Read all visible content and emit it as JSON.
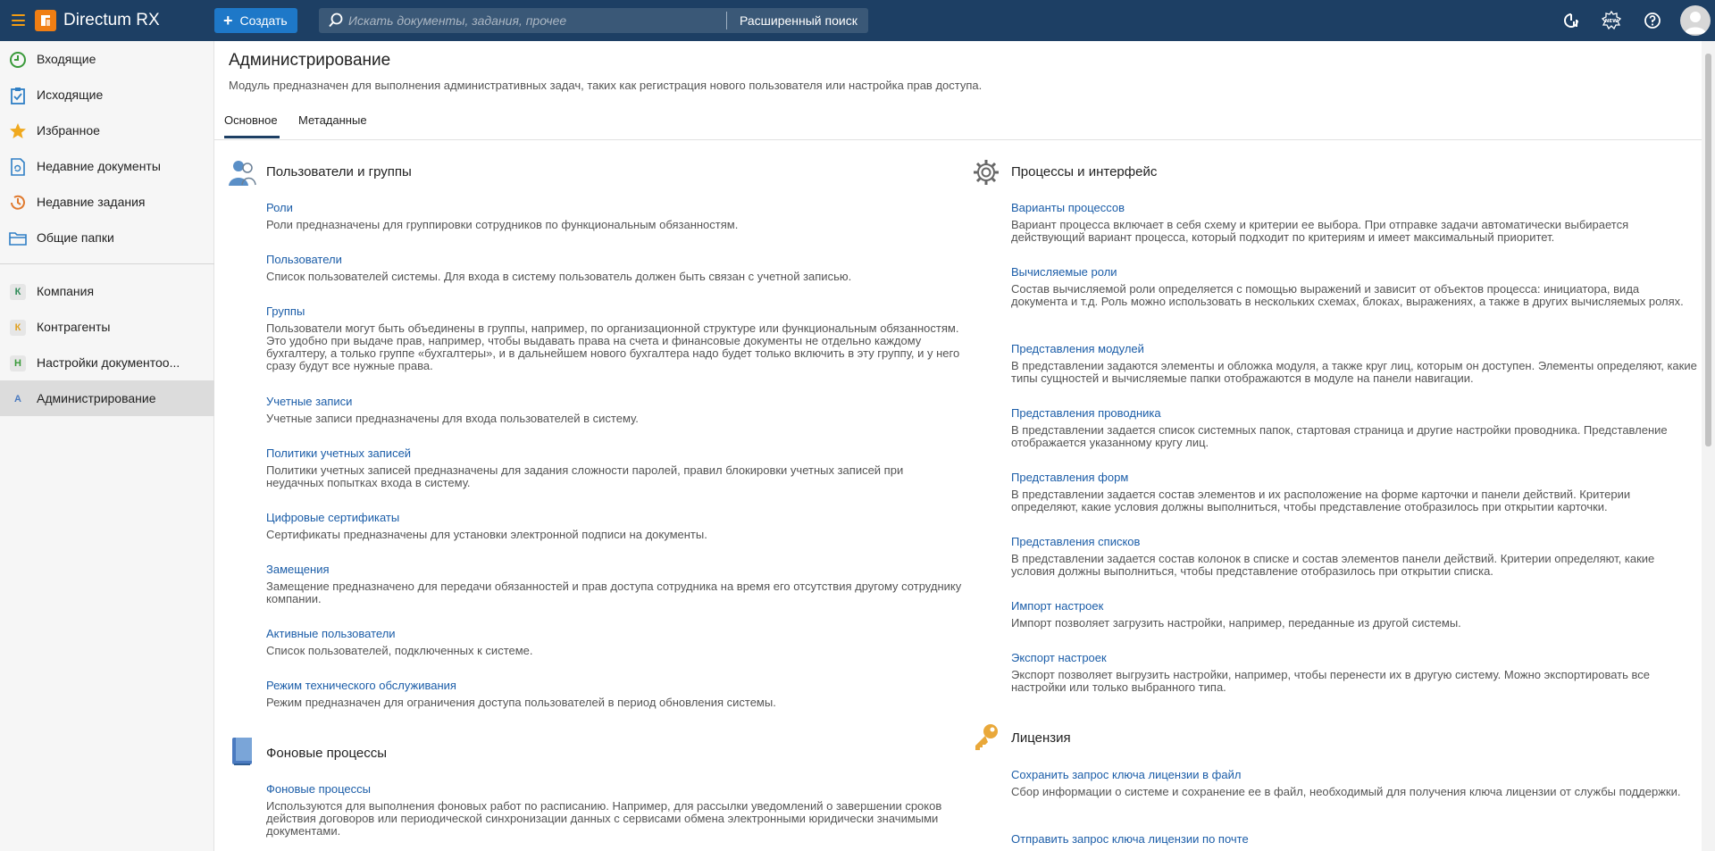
{
  "app": {
    "name": "Directum RX"
  },
  "topbar": {
    "create_label": "Создать",
    "search_placeholder": "Искать документы, задания, прочее",
    "advanced_search_label": "Расширенный поиск"
  },
  "sidebar": {
    "items": [
      {
        "label": "Входящие",
        "icon": "clock-in-icon"
      },
      {
        "label": "Исходящие",
        "icon": "clipboard-check-icon"
      },
      {
        "label": "Избранное",
        "icon": "star-icon"
      },
      {
        "label": "Недавние документы",
        "icon": "recent-docs-icon"
      },
      {
        "label": "Недавние задания",
        "icon": "recent-tasks-icon"
      },
      {
        "label": "Общие папки",
        "icon": "folder-icon"
      }
    ],
    "modules": [
      {
        "letter": "К",
        "label": "Компания",
        "color": "#2e8b57"
      },
      {
        "letter": "К",
        "label": "Контрагенты",
        "color": "#e0a020"
      },
      {
        "letter": "Н",
        "label": "Настройки документоо...",
        "color": "#3a9a3a"
      },
      {
        "letter": "А",
        "label": "Администрирование",
        "color": "#4a7ac0"
      }
    ]
  },
  "page": {
    "title": "Администрирование",
    "description": "Модуль предназначен для выполнения административных задач, таких как регистрация нового пользователя или настройка прав доступа.",
    "tabs": [
      "Основное",
      "Метаданные"
    ]
  },
  "left": {
    "users_title": "Пользователи и группы",
    "users_items": [
      {
        "title": "Роли",
        "desc": "Роли предназначены для группировки сотрудников по функциональным обязанностям."
      },
      {
        "title": "Пользователи",
        "desc": "Список пользователей системы. Для входа в систему пользователь должен быть связан с учетной записью."
      },
      {
        "title": "Группы",
        "desc": "Пользователи могут быть объединены в группы, например, по организационной структуре или функциональным обязанностям. Это удобно при выдаче прав, например, чтобы выдавать права на счета и финансовые документы не отдельно каждому бухгалтеру, а только группе «бухгалтеры», и в дальнейшем нового бухгалтера надо будет только включить в эту группу, и у него сразу будут все нужные права."
      },
      {
        "title": "Учетные записи",
        "desc": "Учетные записи предназначены для входа пользователей в систему."
      },
      {
        "title": "Политики учетных записей",
        "desc": "Политики учетных записей предназначены для задания сложности паролей, правил блокировки учетных записей при неудачных попытках входа в систему."
      },
      {
        "title": "Цифровые сертификаты",
        "desc": "Сертификаты предназначены для установки электронной подписи на документы."
      },
      {
        "title": "Замещения",
        "desc": "Замещение предназначено для передачи обязанностей и прав доступа сотрудника на время его отсутствия другому сотруднику компании."
      },
      {
        "title": "Активные пользователи",
        "desc": "Список пользователей, подключенных к системе."
      },
      {
        "title": "Режим технического обслуживания",
        "desc": "Режим предназначен для ограничения доступа пользователей в период обновления системы."
      }
    ],
    "bg_title": "Фоновые процессы",
    "bg_items": [
      {
        "title": "Фоновые процессы",
        "desc": "Используются для выполнения фоновых работ по расписанию. Например, для рассылки уведомлений о завершении сроков действия договоров или периодической синхронизации данных с сервисами обмена электронными юридически значимыми документами."
      }
    ]
  },
  "right": {
    "proc_title": "Процессы и интерфейс",
    "proc_items": [
      {
        "title": "Варианты процессов",
        "desc": "Вариант процесса включает в себя схему и критерии ее выбора. При отправке задачи автоматически выбирается действующий вариант процесса, который подходит по критериям и имеет максимальный приоритет."
      },
      {
        "title": "Вычисляемые роли",
        "desc": "Состав вычисляемой роли определяется с помощью выражений и зависит от объектов процесса: инициатора, вида документа и т.д. Роль можно использовать в нескольких схемах, блоках, выражениях, а также в других вычисляемых ролях."
      },
      {
        "title": "Представления модулей",
        "desc": "В представлении задаются элементы и обложка модуля, а также круг лиц, которым он доступен. Элементы определяют, какие типы сущностей и вычисляемые папки отображаются в модуле на панели навигации."
      },
      {
        "title": "Представления проводника",
        "desc": "В представлении задается список системных папок, стартовая страница и другие настройки проводника. Представление отображается указанному кругу лиц."
      },
      {
        "title": "Представления форм",
        "desc": "В представлении задается состав элементов и их расположение на форме карточки и панели действий. Критерии определяют, какие условия должны выполниться, чтобы представление отобразилось при открытии карточки."
      },
      {
        "title": "Представления списков",
        "desc": "В представлении задается состав колонок в списке и состав элементов панели действий. Критерии определяют, какие условия должны выполниться, чтобы представление отобразилось при открытии списка."
      },
      {
        "title": "Импорт настроек",
        "desc": "Импорт позволяет загрузить настройки, например, переданные из другой системы."
      },
      {
        "title": "Экспорт настроек",
        "desc": "Экспорт позволяет выгрузить настройки, например, чтобы перенести их в другую систему. Можно экспортировать все настройки или только выбранного типа."
      }
    ],
    "lic_title": "Лицензия",
    "lic_items": [
      {
        "title": "Сохранить запрос ключа лицензии в файл",
        "desc": "Сбор информации о системе и сохранение ее в файл, необходимый для получения ключа лицензии от службы поддержки."
      },
      {
        "title": "Отправить запрос ключа лицензии по почте",
        "desc": ""
      }
    ]
  },
  "colors": {
    "topbar": "#1d3f64",
    "accent": "#f07e13",
    "link": "#1b5da8",
    "create": "#1e78c8"
  }
}
